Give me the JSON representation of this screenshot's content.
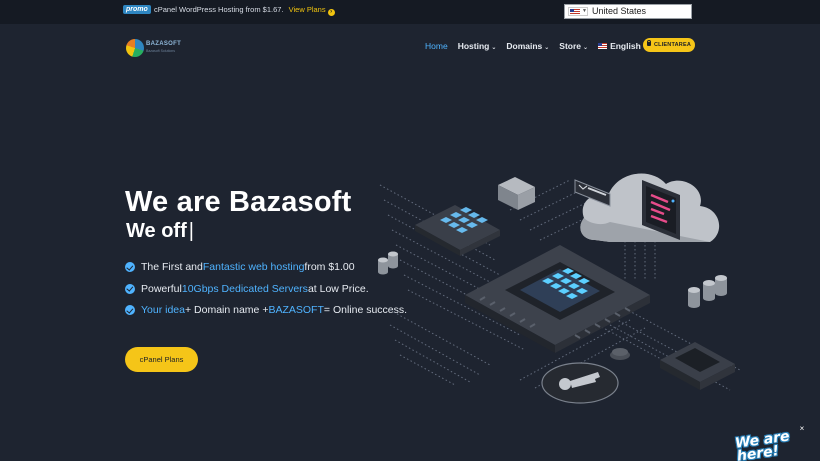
{
  "topbar": {
    "promo_badge": "promo",
    "promo_text": "cPanel WordPress Hosting from $1.67.",
    "promo_link": "View Plans",
    "country": "United States"
  },
  "header": {
    "logo_word": "BAZASOFT",
    "logo_sub": "Bazasoft Solutions",
    "nav": {
      "home": "Home",
      "hosting": "Hosting",
      "domains": "Domains",
      "store": "Store",
      "language": "English"
    },
    "client_area": "CLIENTAREA"
  },
  "hero": {
    "title": "We are Bazasoft",
    "typing": "We off",
    "features": [
      {
        "pre": "The First and ",
        "hl": "Fantastic web hosting",
        "post": " from $1.00"
      },
      {
        "pre": "Powerful ",
        "hl": "10Gbps Dedicated Servers",
        "post": " at Low Price."
      },
      {
        "hl": "Your idea",
        "mid": " + Domain name + ",
        "hl2": "BAZASOFT",
        "post": " = Online success."
      }
    ],
    "cta": "cPanel Plans"
  },
  "badge": {
    "line1": "We are",
    "line2": "here!"
  },
  "colors": {
    "background": "#1e2430",
    "accent_blue": "#4fb3ff",
    "accent_yellow": "#f5c518"
  }
}
